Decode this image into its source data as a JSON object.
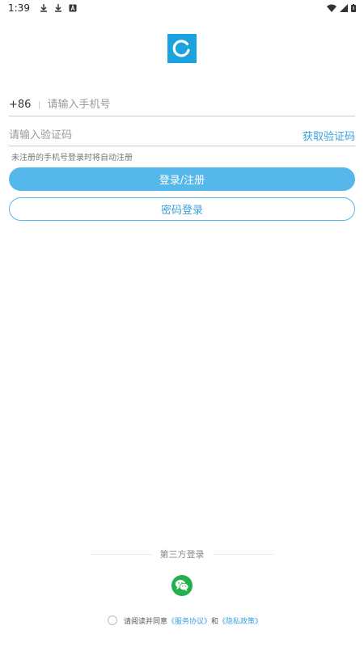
{
  "status_bar": {
    "time": "1:39",
    "icons_left": [
      "download-icon",
      "download-icon",
      "notification-a-icon"
    ],
    "icons_right": [
      "wifi-icon",
      "signal-icon",
      "battery-icon"
    ]
  },
  "app": {
    "logo": "app-logo-c-icon",
    "accent_color": "#56b7ea",
    "link_color": "#3aa2dc"
  },
  "login_form": {
    "country_code": "+86",
    "phone_placeholder": "请输入手机号",
    "phone_value": "",
    "code_placeholder": "请输入验证码",
    "code_value": "",
    "get_code_label": "获取验证码",
    "hint": "未注册的手机号登录时将自动注册",
    "login_button": "登录/注册",
    "password_login_button": "密码登录"
  },
  "third_party": {
    "label": "第三方登录",
    "providers": [
      {
        "icon": "wechat-icon",
        "color": "#22b04a"
      }
    ]
  },
  "agreement": {
    "prefix": "请阅读并同意",
    "service_link": "《服务协议》",
    "conjunction": "和",
    "privacy_link": "《隐私政策》",
    "checked": false
  }
}
